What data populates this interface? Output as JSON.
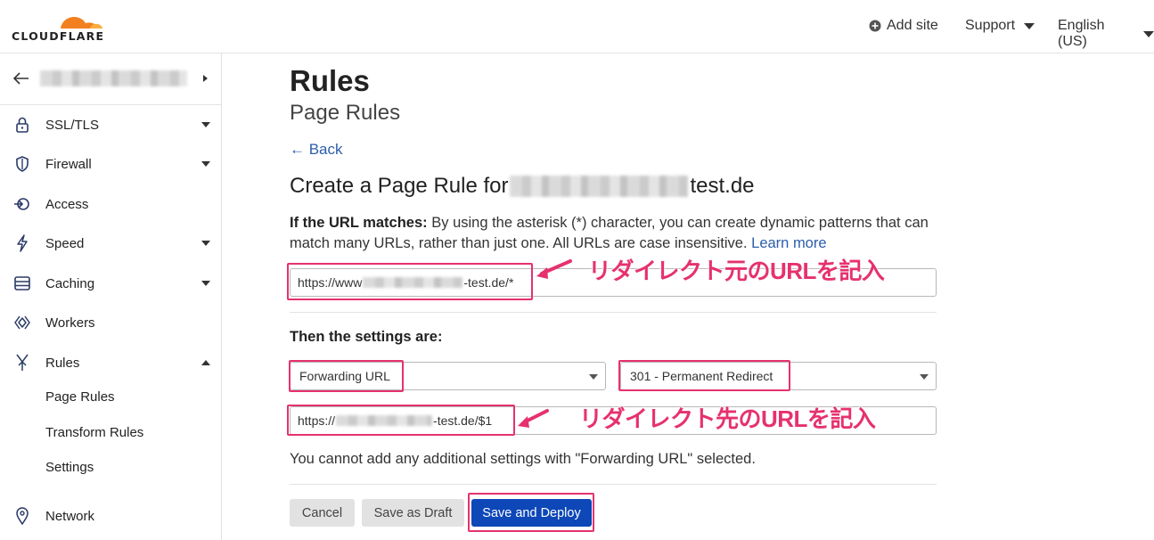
{
  "header": {
    "logo_text": "CLOUDFLARE",
    "add_site": "Add site",
    "support": "Support",
    "language": "English (US)"
  },
  "sidebar": {
    "items": [
      {
        "label": "SSL/TLS",
        "icon": "lock-icon",
        "expandable": true
      },
      {
        "label": "Firewall",
        "icon": "shield-icon",
        "expandable": true
      },
      {
        "label": "Access",
        "icon": "access-icon",
        "expandable": false
      },
      {
        "label": "Speed",
        "icon": "lightning-icon",
        "expandable": true
      },
      {
        "label": "Caching",
        "icon": "server-icon",
        "expandable": true
      },
      {
        "label": "Workers",
        "icon": "workers-icon",
        "expandable": false
      },
      {
        "label": "Rules",
        "icon": "rules-icon",
        "expandable": true,
        "expanded": true
      },
      {
        "label": "Network",
        "icon": "location-pin-icon",
        "expandable": false
      }
    ],
    "rules_sub": [
      "Page Rules",
      "Transform Rules",
      "Settings"
    ]
  },
  "page": {
    "title": "Rules",
    "subtitle": "Page Rules",
    "back": "← Back",
    "heading_prefix": "Create a Page Rule for",
    "heading_suffix": "test.de",
    "if_label": "If the URL matches:",
    "if_desc": " By using the asterisk (*) character, you can create dynamic patterns that can match many URLs, rather than just one. All URLs are case insensitive. ",
    "learn_more": "Learn more",
    "url_prefix": "https://www",
    "url_suffix": "-test.de/*",
    "then_label": "Then the settings are:",
    "setting_select": "Forwarding URL",
    "status_select": "301 - Permanent Redirect",
    "dest_prefix": "https://",
    "dest_suffix": "-test.de/$1",
    "note": "You cannot add any additional settings with \"Forwarding URL\" selected.",
    "cancel": "Cancel",
    "save_draft": "Save as Draft",
    "save_deploy": "Save and Deploy"
  },
  "annotations": {
    "source_url": "リダイレクト元のURLを記入",
    "dest_url": "リダイレクト先のURLを記入"
  },
  "colors": {
    "accent": "#0d47b8",
    "highlight": "#e6316f",
    "link": "#2c5dab",
    "logo_orange": "#f38020"
  }
}
